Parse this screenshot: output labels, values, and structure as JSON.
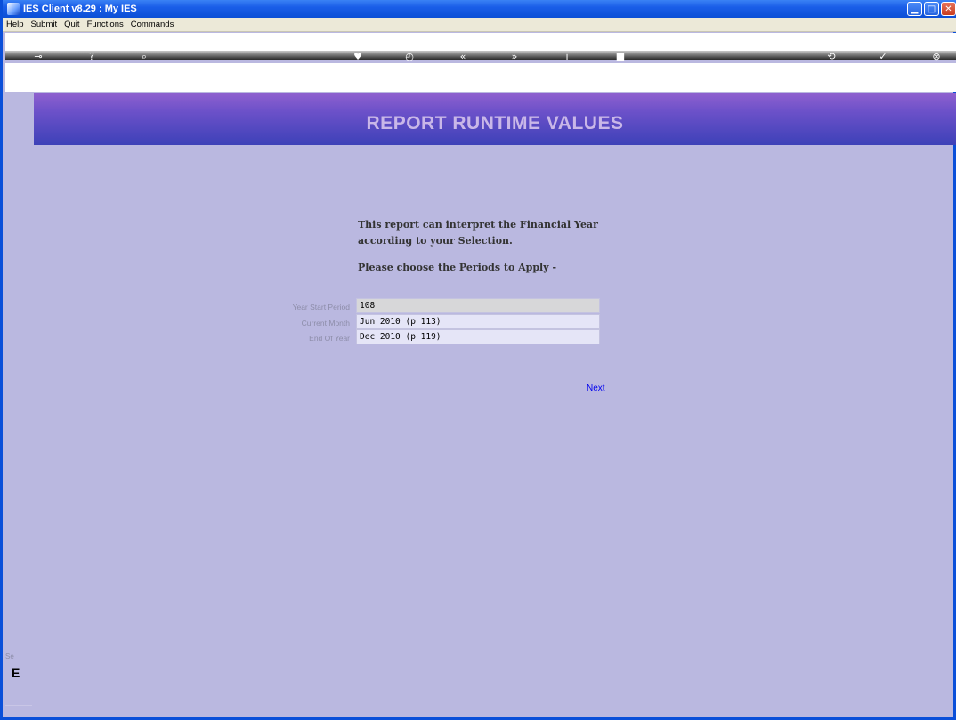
{
  "window": {
    "title": "IES Client v8.29 : My IES"
  },
  "menu": [
    "Help",
    "Submit",
    "Quit",
    "Functions",
    "Commands"
  ],
  "toolbar": {
    "icons": [
      "key-icon",
      "help-icon",
      "search-icon",
      "heart-icon",
      "clock-icon",
      "rewind-icon",
      "fastforward-icon",
      "info-icon",
      "stop-icon",
      "sync-icon",
      "check-icon",
      "close-icon"
    ]
  },
  "banner": {
    "title": "REPORT RUNTIME VALUES"
  },
  "content": {
    "intro_line1": "This report can interpret the Financial Year",
    "intro_line2": "according to your Selection.",
    "prompt": "Please choose the Periods to Apply -",
    "fields": [
      {
        "label": "Year Start Period",
        "value": "108"
      },
      {
        "label": "Current Month",
        "value": "Jun 2010 (p 113)"
      },
      {
        "label": "End Of Year",
        "value": "Dec 2010 (p 119)"
      }
    ],
    "next_label": "Next"
  },
  "side": {
    "frag1": "Se",
    "frag2": "E"
  },
  "colors": {
    "title_bar": "#0b4fd6",
    "background": "#bab8e0",
    "banner_top": "#8e60cf",
    "banner_bottom": "#3d41b8",
    "link": "#0000ee"
  }
}
